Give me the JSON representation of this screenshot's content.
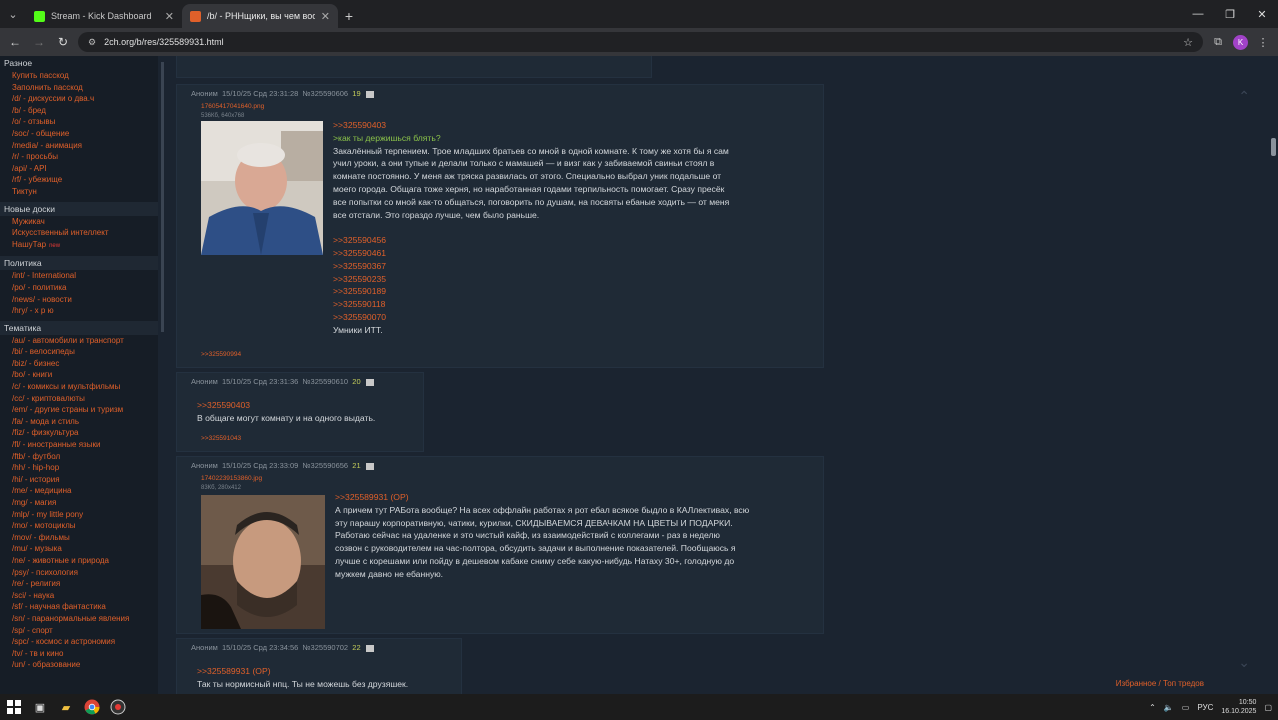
{
  "browser": {
    "tabs": [
      {
        "title": "Stream - Kick Dashboard",
        "favicon_color": "#53fc18"
      },
      {
        "title": "/b/ - РННщики, вы чем вообще",
        "favicon_color": "#e0602a"
      }
    ],
    "url": "2ch.org/b/res/325589931.html",
    "profile_initial": "K"
  },
  "sidebar": {
    "top_head": "Разное",
    "groups": [
      {
        "items": [
          "Купить пасскод",
          "Заполнить пасскод",
          "/d/ - дискуссии о два.ч",
          "/b/ - бред",
          "/o/ - отзывы",
          "/soc/ - общение",
          "/media/ - анимация",
          "/r/ - просьбы",
          "/api/ - API",
          "/rf/ - убежище",
          "Тиктун"
        ]
      },
      {
        "head": "Новые доски",
        "items": [
          "Мужикач",
          "Искусственный интеллект",
          "НашуТар"
        ],
        "badge": "new"
      },
      {
        "head": "Политика",
        "items": [
          "/int/ - International",
          "/po/ - политика",
          "/news/ - новости",
          "/hry/ - х р ю"
        ]
      },
      {
        "head": "Тематика",
        "items": [
          "/au/ - автомобили и транспорт",
          "/bi/ - велосипеды",
          "/biz/ - бизнес",
          "/bo/ - книги",
          "/c/ - комиксы и мультфильмы",
          "/cc/ - криптовалюты",
          "/em/ - другие страны и туризм",
          "/fa/ - мода и стиль",
          "/fiz/ - физкультура",
          "/fl/ - иностранные языки",
          "/ftb/ - футбол",
          "/hh/ - hip-hop",
          "/hi/ - история",
          "/me/ - медицина",
          "/mg/ - магия",
          "/mlp/ - my little pony",
          "/mo/ - мотоциклы",
          "/mov/ - фильмы",
          "/mu/ - музыка",
          "/ne/ - животные и природа",
          "/psy/ - психология",
          "/re/ - религия",
          "/sci/ - наука",
          "/sf/ - научная фантастика",
          "/sn/ - паранормальные явления",
          "/sp/ - спорт",
          "/spc/ - космос и астрономия",
          "/tv/ - тв и кино",
          "/un/ - образование"
        ]
      }
    ]
  },
  "posts": [
    {
      "author": "Аноним",
      "date": "15/10/25 Срд 23:31:28",
      "id": "№325590606",
      "num": "19",
      "file_name": "17605417041640.png",
      "file_info": "536Кб, 640x768",
      "lines": [
        {
          "t": ">>325590403",
          "c": "ref"
        },
        {
          "t": ">как ты держишься блять?",
          "c": "quote"
        },
        {
          "t": "Закалённый терпением. Трое младших братьев со мной в одной комнате. К тому же хотя бы я сам",
          "c": ""
        },
        {
          "t": "учил уроки, а они тупые и делали только с мамашей — и визг как у забиваемой свиньи стоял в",
          "c": ""
        },
        {
          "t": "комнате постоянно. У меня аж тряска развилась от этого. Специально выбрал уник подальше от",
          "c": ""
        },
        {
          "t": "моего города. Общага тоже херня, но наработанная годами терпильность помогает. Сразу пресёк",
          "c": ""
        },
        {
          "t": "все попытки со мной как-то общаться, поговорить по душам, на посвяты ебаные ходить — от меня",
          "c": ""
        },
        {
          "t": "все отстали. Это гораздо лучше, чем было раньше.",
          "c": ""
        },
        {
          "t": "",
          "c": ""
        },
        {
          "t": ">>325590456",
          "c": "ref"
        },
        {
          "t": ">>325590461",
          "c": "ref"
        },
        {
          "t": ">>325590367",
          "c": "ref"
        },
        {
          "t": ">>325590235",
          "c": "ref"
        },
        {
          "t": ">>325590189",
          "c": "ref"
        },
        {
          "t": ">>325590118",
          "c": "ref"
        },
        {
          "t": ">>325590070",
          "c": "ref"
        },
        {
          "t": "Умники ИТТ.",
          "c": ""
        }
      ],
      "reply": ">>325590994"
    },
    {
      "author": "Аноним",
      "date": "15/10/25 Срд 23:31:36",
      "id": "№325590610",
      "num": "20",
      "lines": [
        {
          "t": ">>325590403",
          "c": "ref"
        },
        {
          "t": "В общаге могут комнату и на одного выдать.",
          "c": ""
        }
      ],
      "reply": ">>325591043"
    },
    {
      "author": "Аноним",
      "date": "15/10/25 Срд 23:33:09",
      "id": "№325590656",
      "num": "21",
      "file_name": "17402239153860.jpg",
      "file_info": "83Кб, 280x412",
      "lines": [
        {
          "t": ">>325589931 (OP)",
          "c": "ref"
        },
        {
          "t": "А причем тут РАБота вообще? На всех оффлайн работах я рот ебал всякое быдло в КАЛлективах, всю",
          "c": ""
        },
        {
          "t": "эту парашу корпоративную, чатики, курилки, СКИДЫВАЕМСЯ ДЕВАЧКАМ НА ЦВЕТЫ И ПОДАРКИ.",
          "c": ""
        },
        {
          "t": "Работаю сейчас на удаленке и это чистый кайф, из взаимодействий с коллегами - раз в неделю",
          "c": ""
        },
        {
          "t": "созвон с руководителем на час-полтора, обсудить задачи и выполнение показателей. Пообщаюсь я",
          "c": ""
        },
        {
          "t": "лучше с корешами или пойду в дешевом кабаке сниму себе какую-нибудь Натаху 30+, голодную до",
          "c": ""
        },
        {
          "t": "мужкем давно не ебанную.",
          "c": ""
        }
      ]
    },
    {
      "author": "Аноним",
      "date": "15/10/25 Срд 23:34:56",
      "id": "№325590702",
      "num": "22",
      "lines": [
        {
          "t": ">>325589931 (OP)",
          "c": "ref"
        },
        {
          "t": "Так ты нормисный нпц. Ты не можешь без друзяшек.",
          "c": ""
        }
      ]
    }
  ],
  "footer_link": "Избранное / Топ тредов",
  "taskbar": {
    "tray_lang": "РУС",
    "time": "10:50",
    "date": "16.10.2025"
  },
  "colors": {
    "accent": "#e0602a",
    "quote": "#8bc34a",
    "post_bg": "#1f2a36",
    "page_bg": "#1b2430"
  }
}
